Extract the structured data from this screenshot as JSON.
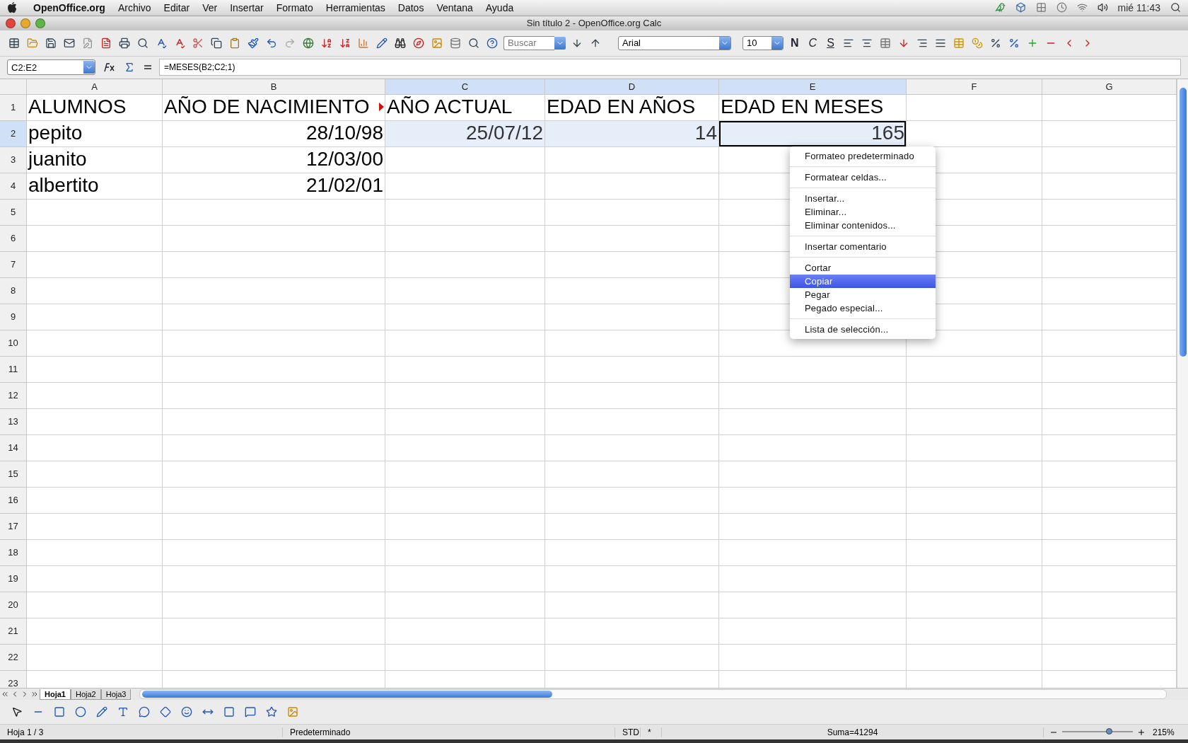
{
  "menu_bar": {
    "app": "OpenOffice.org",
    "items": [
      "Archivo",
      "Editar",
      "Ver",
      "Insertar",
      "Formato",
      "Herramientas",
      "Datos",
      "Ventana",
      "Ayuda"
    ],
    "clock": "mié 11:43"
  },
  "window": {
    "title": "Sin título 2 - OpenOffice.org Calc"
  },
  "toolbar": {
    "search": {
      "placeholder": "Buscar"
    },
    "font": "Arial",
    "size": "10",
    "bold": "N",
    "italic": "C",
    "underline": "S"
  },
  "formula_bar": {
    "name_box": "C2:E2",
    "formula": "=MESES(B2;C2;1)"
  },
  "sheet": {
    "columns": [
      {
        "label": "A",
        "selected": false
      },
      {
        "label": "B",
        "selected": false
      },
      {
        "label": "C",
        "selected": true
      },
      {
        "label": "D",
        "selected": true
      },
      {
        "label": "E",
        "selected": true
      },
      {
        "label": "F",
        "selected": false
      },
      {
        "label": "G",
        "selected": false
      }
    ],
    "rows": [
      {
        "label": "1",
        "selected": false,
        "cells": [
          {
            "text": "ALUMNOS",
            "kind": "text",
            "cursor": false,
            "clipped": false
          },
          {
            "text": "AÑO DE NACIMIENTO",
            "kind": "text",
            "cursor": false,
            "clipped": true
          },
          {
            "text": "AÑO ACTUAL",
            "kind": "text",
            "cursor": false,
            "clipped": false
          },
          {
            "text": "EDAD EN AÑOS",
            "kind": "text",
            "cursor": false,
            "clipped": false
          },
          {
            "text": "EDAD EN MESES",
            "kind": "text",
            "cursor": false,
            "clipped": false
          }
        ]
      },
      {
        "label": "2",
        "selected": true,
        "cells": [
          {
            "text": "pepito",
            "kind": "text",
            "cursor": false,
            "clipped": false
          },
          {
            "text": "28/10/98",
            "kind": "number",
            "cursor": false,
            "clipped": false
          },
          {
            "text": "25/07/12",
            "kind": "number",
            "cursor": false,
            "clipped": false
          },
          {
            "text": "14",
            "kind": "number",
            "cursor": false,
            "clipped": false
          },
          {
            "text": "165",
            "kind": "number",
            "cursor": true,
            "clipped": false
          }
        ]
      },
      {
        "label": "3",
        "selected": false,
        "cells": [
          {
            "text": "juanito",
            "kind": "text",
            "cursor": false,
            "clipped": false
          },
          {
            "text": "12/03/00",
            "kind": "number",
            "cursor": false,
            "clipped": false
          }
        ]
      },
      {
        "label": "4",
        "selected": false,
        "cells": [
          {
            "text": "albertito",
            "kind": "text",
            "cursor": false,
            "clipped": false
          },
          {
            "text": "21/02/01",
            "kind": "number",
            "cursor": false,
            "clipped": false
          }
        ]
      },
      {
        "label": "5",
        "selected": false
      },
      {
        "label": "6",
        "selected": false
      },
      {
        "label": "7",
        "selected": false
      },
      {
        "label": "8",
        "selected": false
      },
      {
        "label": "9",
        "selected": false
      },
      {
        "label": "10",
        "selected": false
      },
      {
        "label": "11",
        "selected": false
      },
      {
        "label": "12",
        "selected": false
      },
      {
        "label": "13",
        "selected": false
      },
      {
        "label": "14",
        "selected": false
      },
      {
        "label": "15",
        "selected": false
      },
      {
        "label": "16",
        "selected": false
      },
      {
        "label": "17",
        "selected": false
      },
      {
        "label": "18",
        "selected": false
      },
      {
        "label": "19",
        "selected": false
      },
      {
        "label": "20",
        "selected": false
      },
      {
        "label": "21",
        "selected": false
      },
      {
        "label": "22",
        "selected": false
      },
      {
        "label": "23",
        "selected": false
      }
    ]
  },
  "context_menu": {
    "groups": [
      [
        {
          "label": "Formateo predeterminado",
          "selected": false
        }
      ],
      [
        {
          "label": "Formatear celdas...",
          "selected": false
        }
      ],
      [
        {
          "label": "Insertar...",
          "selected": false
        },
        {
          "label": "Eliminar...",
          "selected": false
        },
        {
          "label": "Eliminar contenidos...",
          "selected": false
        }
      ],
      [
        {
          "label": "Insertar comentario",
          "selected": false
        }
      ],
      [
        {
          "label": "Cortar",
          "selected": false
        },
        {
          "label": "Copiar",
          "selected": true
        },
        {
          "label": "Pegar",
          "selected": false
        },
        {
          "label": "Pegado especial...",
          "selected": false
        }
      ],
      [
        {
          "label": "Lista de selección...",
          "selected": false
        }
      ]
    ]
  },
  "sheet_tabs": [
    {
      "label": "Hoja1",
      "selected": true
    },
    {
      "label": "Hoja2",
      "selected": false
    },
    {
      "label": "Hoja3",
      "selected": false
    }
  ],
  "status_bar": {
    "sheet": "Hoja 1 / 3",
    "style": "Predeterminado",
    "mode": "STD",
    "modified": "*",
    "sum": "Suma=41294",
    "zoom": {
      "level": 0.67,
      "reading": "215%"
    }
  }
}
